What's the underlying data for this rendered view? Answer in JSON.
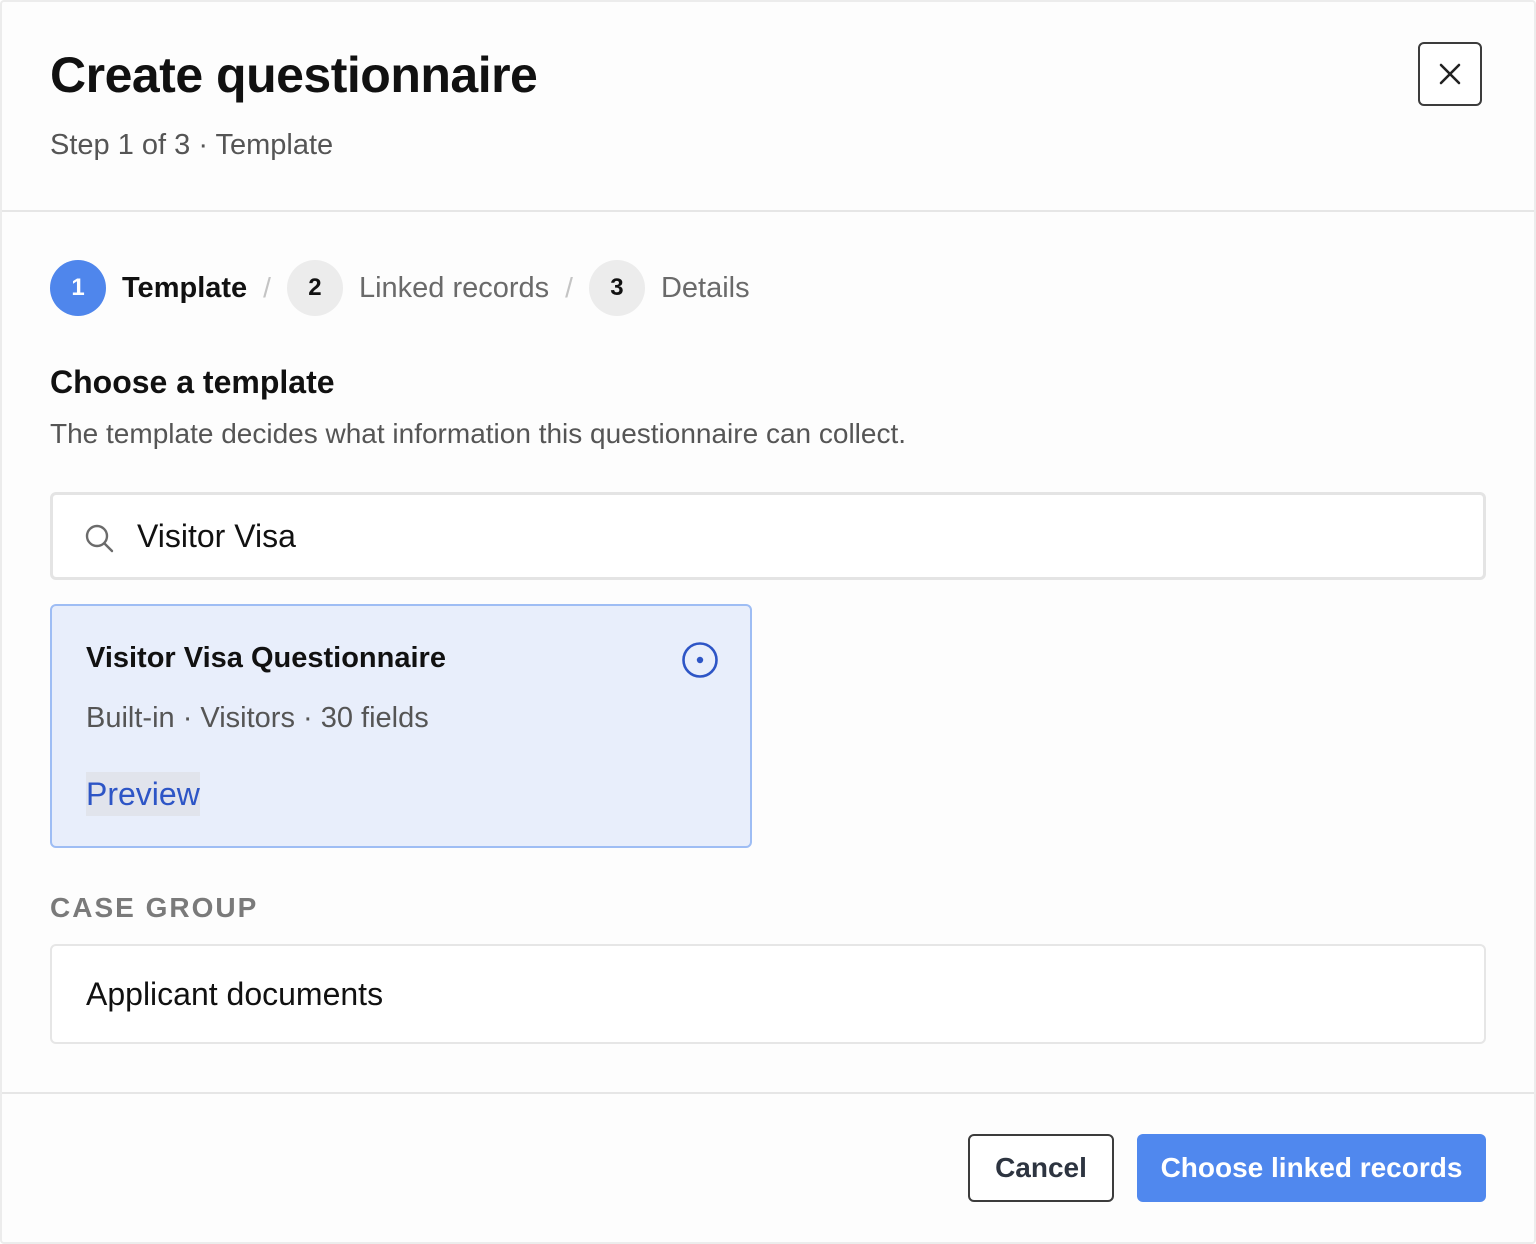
{
  "dialog": {
    "title": "Create questionnaire",
    "subtitle": "Step 1 of 3 · Template",
    "close_icon": "close-icon"
  },
  "stepper": {
    "separator": "/",
    "steps": [
      {
        "number": "1",
        "label": "Template",
        "state": "active"
      },
      {
        "number": "2",
        "label": "Linked records",
        "state": "inactive"
      },
      {
        "number": "3",
        "label": "Details",
        "state": "inactive"
      }
    ]
  },
  "section": {
    "title": "Choose a template",
    "description": "The template decides what information this questionnaire can collect."
  },
  "search": {
    "icon": "search-icon",
    "value": "Visitor Visa",
    "placeholder": ""
  },
  "template_card": {
    "title": "Visitor Visa Questionnaire",
    "meta": "Built-in · Visitors · 30 fields",
    "preview_label": "Preview",
    "selected": true
  },
  "case_group": {
    "label": "CASE GROUP",
    "value": "Applicant documents"
  },
  "footer": {
    "cancel_label": "Cancel",
    "primary_label": "Choose linked records"
  },
  "colors": {
    "accent": "#4f86ec",
    "link": "#2d55c6",
    "card_bg": "#e8eefb",
    "card_border": "#9ebdf4"
  }
}
